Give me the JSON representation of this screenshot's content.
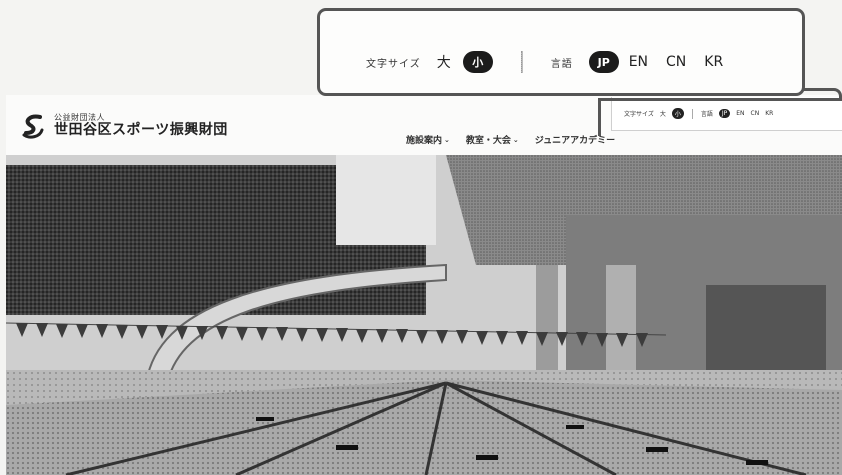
{
  "site": {
    "org_type": "公益財団法人",
    "org_name": "世田谷区スポーツ振興財団",
    "mini_util": {
      "font_size_label": "文字サイズ",
      "large": "大",
      "small": "小",
      "language_label": "言語",
      "languages": [
        "JP",
        "EN",
        "CN",
        "KR"
      ]
    },
    "nav": [
      {
        "label": "施設案内",
        "chevron": "chevron-down-icon"
      },
      {
        "label": "教室・大会",
        "chevron": "chevron-down-icon"
      },
      {
        "label": "ジュニアアカデミー",
        "chevron": ""
      }
    ]
  },
  "callout": {
    "font_size_label": "文字サイズ",
    "large": "大",
    "small": "小",
    "language_label": "言語",
    "languages": [
      "JP",
      "EN",
      "CN",
      "KR"
    ],
    "selected_font_size": "小",
    "selected_language": "JP"
  },
  "colors": {
    "accent_dark": "#1b1b1b",
    "callout_border": "#555555"
  }
}
